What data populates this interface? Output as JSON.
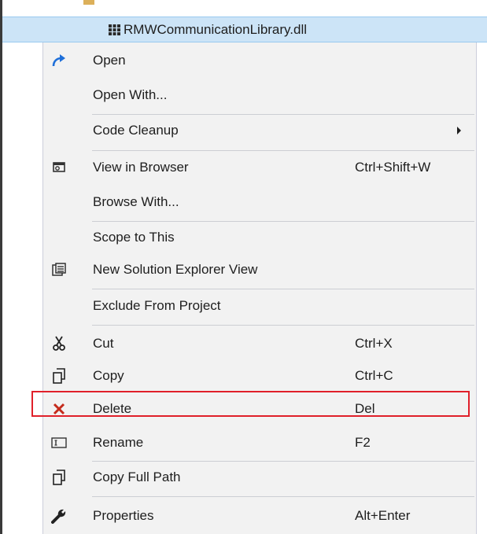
{
  "solution_explorer": {
    "selected_file": "RMWCommunicationLibrary.dll"
  },
  "context_menu": {
    "items": [
      {
        "label": "Open",
        "shortcut": "",
        "icon": "open-arrow-icon"
      },
      {
        "label": "Open With...",
        "shortcut": "",
        "icon": ""
      },
      {
        "label": "Code Cleanup",
        "shortcut": "",
        "icon": "",
        "submenu": true
      },
      {
        "label": "View in Browser",
        "shortcut": "Ctrl+Shift+W",
        "icon": "browser-icon"
      },
      {
        "label": "Browse With...",
        "shortcut": "",
        "icon": ""
      },
      {
        "label": "Scope to This",
        "shortcut": "",
        "icon": ""
      },
      {
        "label": "New Solution Explorer View",
        "shortcut": "",
        "icon": "new-explorer-view-icon"
      },
      {
        "label": "Exclude From Project",
        "shortcut": "",
        "icon": ""
      },
      {
        "label": "Cut",
        "shortcut": "Ctrl+X",
        "icon": "scissors-icon"
      },
      {
        "label": "Copy",
        "shortcut": "Ctrl+C",
        "icon": "copy-icon"
      },
      {
        "label": "Delete",
        "shortcut": "Del",
        "icon": "delete-x-icon",
        "highlighted": true
      },
      {
        "label": "Rename",
        "shortcut": "F2",
        "icon": "rename-icon"
      },
      {
        "label": "Copy Full Path",
        "shortcut": "",
        "icon": "copy-path-icon"
      },
      {
        "label": "Properties",
        "shortcut": "Alt+Enter",
        "icon": "wrench-icon"
      }
    ]
  },
  "colors": {
    "menu_background": "#f2f2f2",
    "selection_background": "#cce4f7",
    "highlight_outline": "#e0202a",
    "delete_icon": "#c42b1c",
    "open_icon": "#1e6fd9"
  }
}
